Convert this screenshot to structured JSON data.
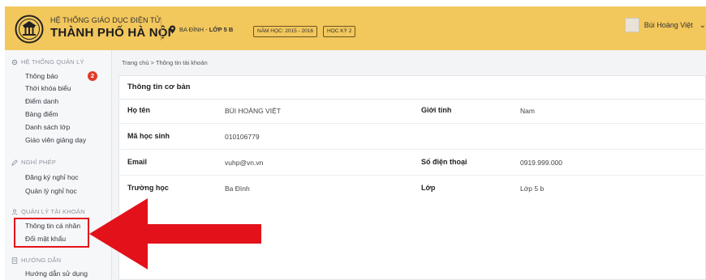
{
  "header": {
    "brand_top": "HỆ THỐNG GIÁO DỤC ĐIỆN TỬ",
    "brand_main": "THÀNH PHỐ HÀ NỘI",
    "location_district": "BA ĐÌNH",
    "location_sep": " - ",
    "location_class": "LỚP 5 B",
    "school_year": "NĂM HỌC: 2015 - 2016",
    "term": "HỌC KỲ 2",
    "user_name": "Bùi Hoàng Việt"
  },
  "sidebar": {
    "sections": [
      {
        "label": "HỆ THỐNG QUẢN LÝ",
        "icon": "gear-icon"
      },
      {
        "label": "NGHỈ PHÉP",
        "icon": "pencil-icon"
      },
      {
        "label": "QUẢN LÝ TÀI KHOẢN",
        "icon": "user-icon"
      },
      {
        "label": "HƯỚNG DẪN",
        "icon": "document-icon"
      }
    ],
    "items": [
      {
        "label": "Thông báo"
      },
      {
        "label": "Thời khóa biểu"
      },
      {
        "label": "Điểm danh"
      },
      {
        "label": "Bảng điểm"
      },
      {
        "label": "Danh sách lớp"
      },
      {
        "label": "Giáo viên giảng dạy"
      },
      {
        "label": "Đăng ký nghỉ học"
      },
      {
        "label": "Quản lý nghỉ học"
      },
      {
        "label": "Thông tin cá nhân"
      },
      {
        "label": "Đổi mật khẩu"
      },
      {
        "label": "Hướng dẫn sử dụng"
      }
    ],
    "notification_count": "2"
  },
  "breadcrumb": "Trang chủ > Thông tin tài khoản",
  "card": {
    "title": "Thông tin cơ bản",
    "fields": {
      "name_label": "Họ tên",
      "name_value": "BÙI HOÀNG VIỆT",
      "gender_label": "Giới tính",
      "gender_value": "Nam",
      "student_id_label": "Mã học sinh",
      "student_id_value": "010106779",
      "email_label": "Email",
      "email_value": "vuhp@vn.vn",
      "phone_label": "Số điện thoại",
      "phone_value": "0919.999.000",
      "school_label": "Trường học",
      "school_value": "Ba Đình",
      "class_label": "Lớp",
      "class_value": "Lớp 5 b"
    }
  },
  "colors": {
    "header_bg": "#f2c75c",
    "highlight_red": "#e3111a",
    "badge_red": "#e03b2b"
  }
}
